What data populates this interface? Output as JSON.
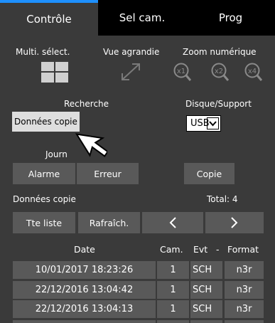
{
  "tabs": [
    {
      "label": "Contrôle"
    },
    {
      "label": "Sel cam."
    },
    {
      "label": "Prog"
    }
  ],
  "view": {
    "multi_select": "Multi. sélect.",
    "enlarged_view": "Vue agrandie",
    "digital_zoom": "Zoom numérique",
    "zoom_1": "x1",
    "zoom_2": "x2",
    "zoom_4": "x4"
  },
  "search": {
    "label": "Recherche",
    "copy_data_button": "Données copie"
  },
  "disk": {
    "label": "Disque/Support",
    "selected": "USB"
  },
  "journal": {
    "label": "Journ",
    "alarm_button": "Alarme",
    "error_button": "Erreur",
    "copy_button": "Copie"
  },
  "copy_data": {
    "label": "Données copie",
    "total": "Total: 4",
    "all_list_button": "Tte liste",
    "refresh_button": "Rafraîch.",
    "prev": "<",
    "next": ">"
  },
  "table": {
    "headers": {
      "date": "Date",
      "cam": "Cam.",
      "evt": "Evt",
      "sep": "-",
      "format": "Format"
    },
    "rows": [
      {
        "date": "10/01/2017  18:23:26",
        "cam": "1",
        "evt": "SCH",
        "format": "n3r"
      },
      {
        "date": "22/12/2016  13:04:42",
        "cam": "1",
        "evt": "SCH",
        "format": "n3r"
      },
      {
        "date": "22/12/2016  13:04:13",
        "cam": "1",
        "evt": "SCH",
        "format": "n3r"
      },
      {
        "date": "",
        "cam": "",
        "evt": "",
        "format": ""
      }
    ]
  }
}
